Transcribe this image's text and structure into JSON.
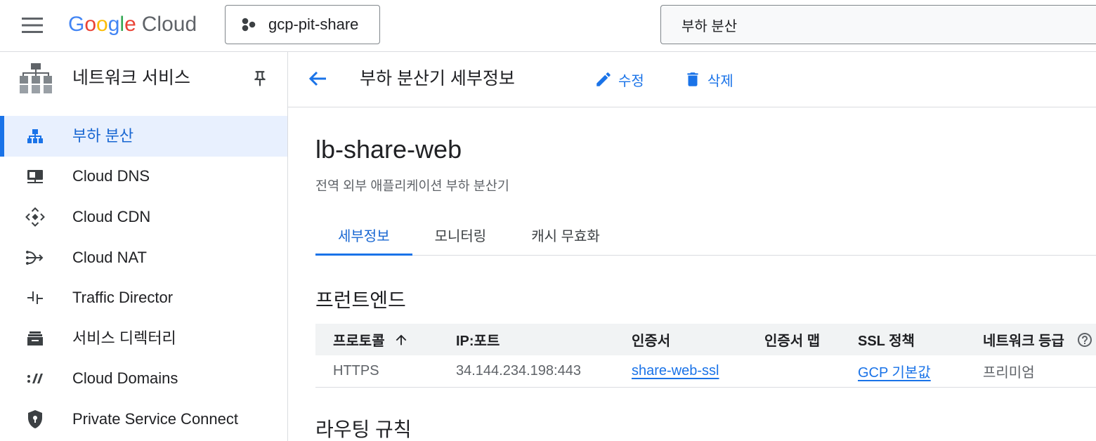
{
  "header": {
    "menu_icon": "menu-icon",
    "logo": {
      "brand": "Google",
      "product": "Cloud",
      "letter_colors": [
        "#4285f4",
        "#ea4335",
        "#fbbc04",
        "#4285f4",
        "#34a853",
        "#ea4335"
      ],
      "product_color": "#5f6368"
    },
    "project": {
      "name": "gcp-pit-share",
      "icon": "project-icon"
    },
    "search": {
      "value": "부하 분산"
    }
  },
  "sidebar": {
    "title": "네트워크 서비스",
    "title_icon": "network-services-icon",
    "pin_icon": "pin-icon",
    "items": [
      {
        "label": "부하 분산",
        "icon": "load-balancing-icon",
        "active": true
      },
      {
        "label": "Cloud DNS",
        "icon": "cloud-dns-icon",
        "active": false
      },
      {
        "label": "Cloud CDN",
        "icon": "cloud-cdn-icon",
        "active": false
      },
      {
        "label": "Cloud NAT",
        "icon": "cloud-nat-icon",
        "active": false
      },
      {
        "label": "Traffic Director",
        "icon": "traffic-director-icon",
        "active": false
      },
      {
        "label": "서비스 디렉터리",
        "icon": "service-directory-icon",
        "active": false
      },
      {
        "label": "Cloud Domains",
        "icon": "cloud-domains-icon",
        "active": false
      },
      {
        "label": "Private Service Connect",
        "icon": "private-service-connect-icon",
        "active": false
      }
    ]
  },
  "page_header": {
    "back_icon": "arrow-back-icon",
    "title": "부하 분산기 세부정보",
    "edit": {
      "label": "수정",
      "icon": "edit-icon"
    },
    "delete": {
      "label": "삭제",
      "icon": "delete-icon"
    }
  },
  "load_balancer": {
    "name": "lb-share-web",
    "type": "전역 외부 애플리케이션 부하 분산기"
  },
  "tabs": [
    {
      "label": "세부정보",
      "active": true
    },
    {
      "label": "모니터링",
      "active": false
    },
    {
      "label": "캐시 무효화",
      "active": false
    }
  ],
  "frontend": {
    "heading": "프런트엔드",
    "columns": [
      "프로토콜",
      "IP:포트",
      "인증서",
      "인증서 맵",
      "SSL 정책",
      "네트워크 등급"
    ],
    "sort": {
      "column_index": 0,
      "direction": "ascending",
      "icon": "arrow-upward-icon"
    },
    "help_icon": "help-icon",
    "rows": [
      {
        "protocol": "HTTPS",
        "ip_port": "34.144.234.198:443",
        "certificate": "share-web-ssl",
        "certificate_map": "",
        "ssl_policy": "GCP 기본값",
        "network_tier": "프리미엄"
      }
    ]
  },
  "routing_rules": {
    "heading": "라우팅 규칙"
  },
  "colors": {
    "accent": "#1a73e8",
    "active_text": "#1967d2",
    "active_bg": "#e8f0fe",
    "text": "#202124",
    "secondary_text": "#5f6368",
    "border": "#dadce0",
    "table_header_bg": "#f1f3f4"
  }
}
